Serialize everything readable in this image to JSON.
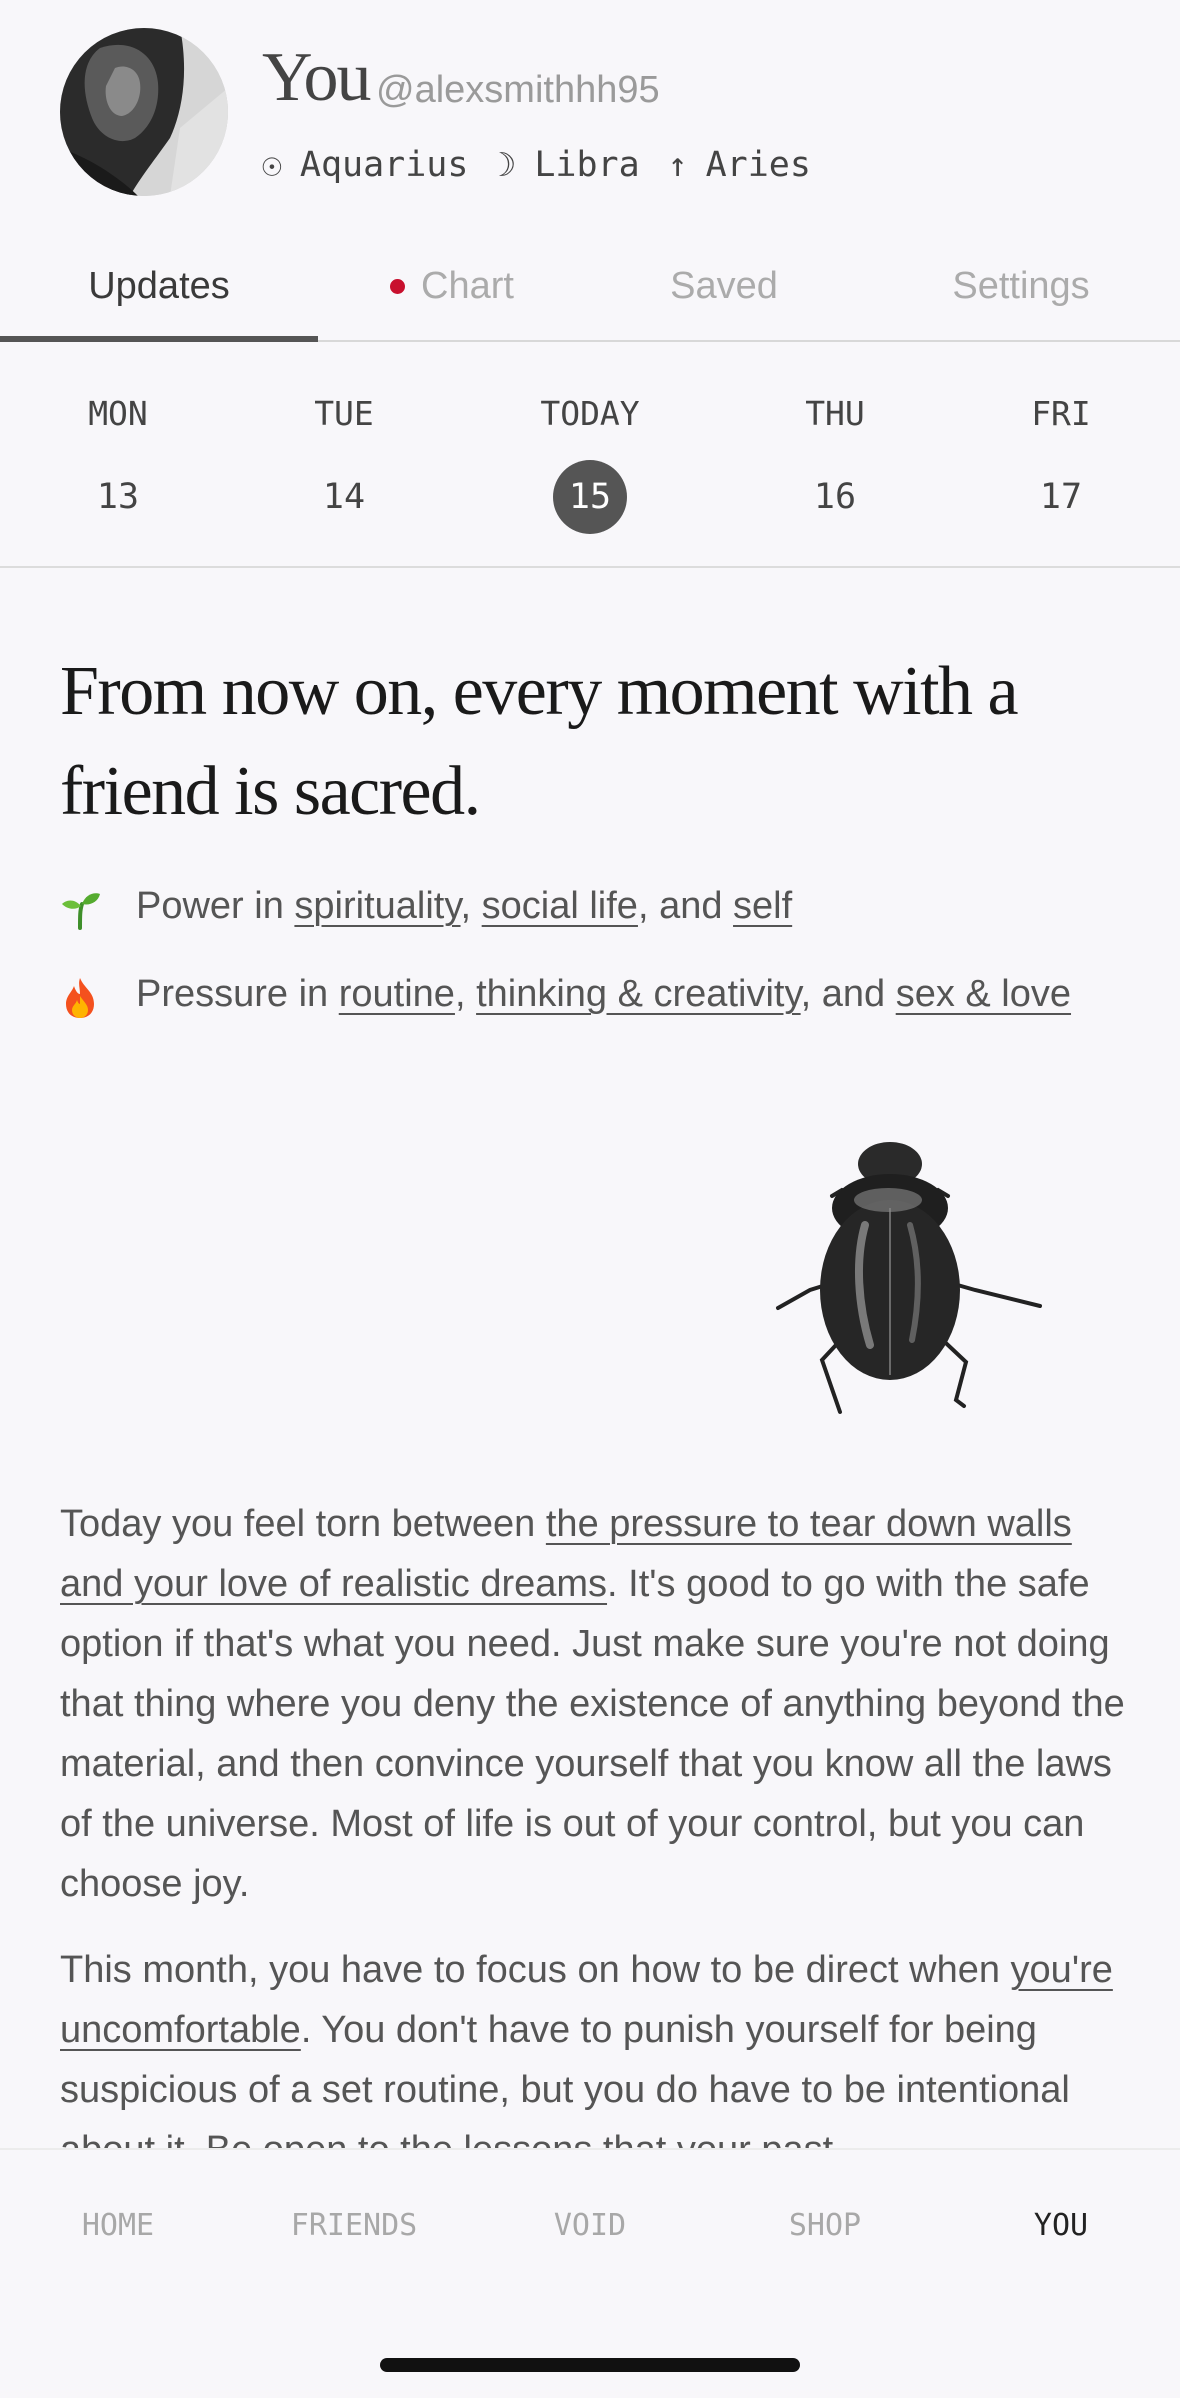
{
  "profile": {
    "name": "You",
    "handle": "@alexsmithhh95",
    "signs": [
      {
        "glyph": "☉",
        "label": "Aquarius",
        "icon": "sun-icon"
      },
      {
        "glyph": "☽",
        "label": "Libra",
        "icon": "moon-icon"
      },
      {
        "glyph": "↑",
        "label": "Aries",
        "icon": "rising-icon"
      }
    ]
  },
  "tabs": [
    {
      "label": "Updates",
      "active": true
    },
    {
      "label": "Chart",
      "active": false,
      "dot_color": "#c8102e"
    },
    {
      "label": "Saved",
      "active": false
    },
    {
      "label": "Settings",
      "active": false
    }
  ],
  "days": [
    {
      "name": "MON",
      "num": "13",
      "today": false
    },
    {
      "name": "TUE",
      "num": "14",
      "today": false
    },
    {
      "name": "TODAY",
      "num": "15",
      "today": true
    },
    {
      "name": "THU",
      "num": "16",
      "today": false
    },
    {
      "name": "FRI",
      "num": "17",
      "today": false
    }
  ],
  "headline": "From now on, every moment with a friend is sacred.",
  "power": {
    "prefix": "Power in ",
    "items": [
      "spirituality",
      "social life",
      "self"
    ],
    "icon": "seedling-icon"
  },
  "pressure": {
    "prefix": "Pressure in ",
    "items": [
      "routine",
      "thinking & creativity",
      "sex & love"
    ],
    "icon": "fire-icon"
  },
  "paragraph1": {
    "lead": "Today you feel torn between ",
    "link": "the pressure to tear down walls and your love of realistic dreams",
    "rest": ". It's good to go with the safe option if that's what you need. Just make sure you're not doing that thing where you deny the existence of anything beyond the material, and then convince yourself that you know all the laws of the universe. Most of life is out of your control, but you can choose joy."
  },
  "paragraph2": {
    "lead": "This month, you have to focus on how to be direct when ",
    "link": "you're uncomfortable",
    "rest": ". You don't have to punish yourself for being suspicious of a set routine, but you do have to be intentional about it. Be open to the lessons that your past"
  },
  "nav": [
    {
      "label": "HOME",
      "active": false
    },
    {
      "label": "FRIENDS",
      "active": false
    },
    {
      "label": "VOID",
      "active": false
    },
    {
      "label": "SHOP",
      "active": false
    },
    {
      "label": "YOU",
      "active": true
    }
  ]
}
